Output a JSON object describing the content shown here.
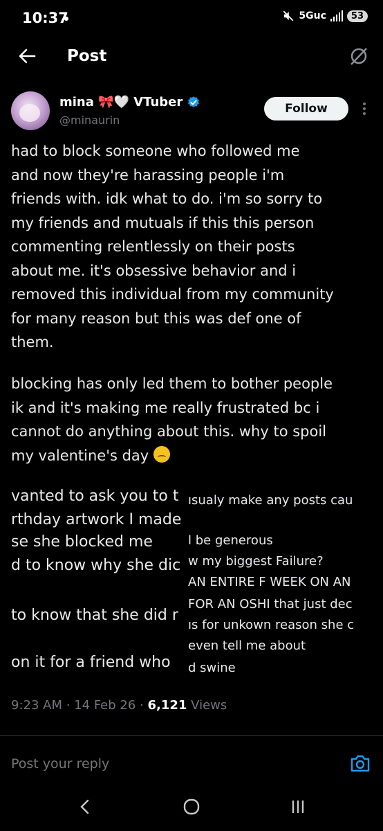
{
  "status_bar": {
    "time": "10:37",
    "network": "5Guc",
    "battery": "53",
    "icons": [
      "mute-icon",
      "signal-icon"
    ]
  },
  "topbar": {
    "title": "Post",
    "icons": [
      "back-arrow-icon",
      "grok-icon"
    ]
  },
  "author": {
    "name": "mina 🎀🤍 VTuber",
    "handle": "@minaurin",
    "verified": true,
    "follow_label": "Follow"
  },
  "post": {
    "paragraph_1": [
      "had to block someone who followed me",
      "and now they're harassing people i'm",
      "friends with. idk what to do. i'm so sorry to",
      "my friends and mutuals if this this person",
      "commenting relentlessly on their posts",
      "about me. it's obsessive behavior and i",
      "removed this individual from my community",
      "for many reason but this was def one of",
      "them."
    ],
    "paragraph_2": [
      "blocking has only led them to bother people",
      "ik and it's making me really frustrated bc i",
      "cannot do anything about this. why to spoil",
      "my valentine's day"
    ],
    "overlay_left": [
      "vanted to ask you to t",
      "rthday artwork I made",
      "se she blocked me",
      "d to know why she dic",
      "to know that she did r",
      " on it for a friend who"
    ],
    "overlay_right": [
      "ısualy make any posts cau",
      "l be generous",
      "w my biggest Failure?",
      "AN ENTIRE F WEEK ON AN",
      "FOR AN OSHI that just dec",
      "ıs for unkown reason she c",
      "even tell me about",
      "d swine"
    ]
  },
  "meta": {
    "time": "9:23 AM",
    "date": "14 Feb 26",
    "views_count": "6,121",
    "views_label": "Views"
  },
  "reply": {
    "placeholder": "Post your reply"
  },
  "colors": {
    "background": "#000000",
    "text": "#e7e9ea",
    "muted": "#71767b",
    "accent": "#1d9bf0"
  }
}
